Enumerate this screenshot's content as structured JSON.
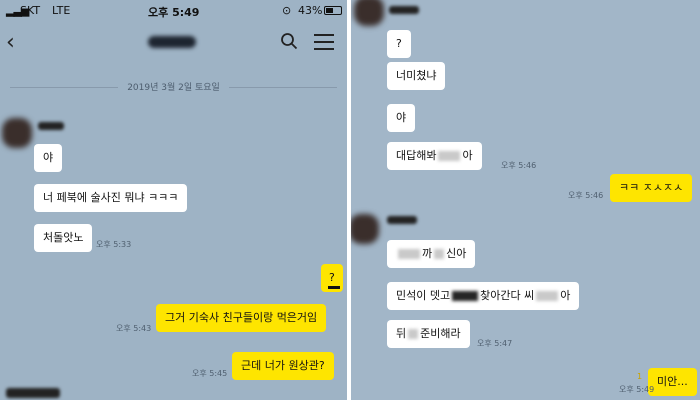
{
  "status": {
    "carrier": "SKT",
    "network": "LTE",
    "time": "오후 5:49",
    "battery": "43%"
  },
  "date_separator": "2019년 3월 2일 토요일",
  "left_messages": [
    {
      "text": "야",
      "from": "them"
    },
    {
      "text": "너 페북에 술사진 뭐냐 ㅋㅋㅋ",
      "from": "them"
    },
    {
      "text": "처돌앗노",
      "from": "them"
    },
    {
      "time": "오후 5:33"
    },
    {
      "text": "?",
      "from": "me"
    },
    {
      "text": "그거 기숙사 친구들이랑 먹은거임",
      "from": "me",
      "time": "오후 5:43"
    },
    {
      "text": "근데 너가 원상관?",
      "from": "me",
      "time": "오후 5:45"
    }
  ],
  "right_messages": [
    {
      "text": "?",
      "from": "them"
    },
    {
      "text": "너미쳤냐",
      "from": "them"
    },
    {
      "text": "야",
      "from": "them"
    },
    {
      "text_before": "대답해봐",
      "text_after": "아",
      "from": "them",
      "time": "오후 5:46"
    },
    {
      "text": "ㅋㅋ ㅈㅅㅈㅅ",
      "from": "me",
      "time": "오후 5:46"
    },
    {
      "text_before": "",
      "text_mid": "까",
      "text_after": "신아",
      "from": "them"
    },
    {
      "text_before": "민석이 뎃고",
      "text_mid": "찾아간다 씨",
      "text_after": "아",
      "from": "them"
    },
    {
      "text_before": "뒤",
      "text_after": "준비해라",
      "from": "them",
      "time": "오후 5:47"
    },
    {
      "text": "미안...",
      "from": "me",
      "time": "오후 5:49",
      "unread": "1"
    }
  ],
  "colors": {
    "background": "#9eb3c5",
    "my_bubble": "#fee500",
    "their_bubble": "#ffffff"
  },
  "icons": [
    "back-arrow-icon",
    "search-icon",
    "menu-icon",
    "lock-rotation-icon",
    "battery-icon"
  ]
}
